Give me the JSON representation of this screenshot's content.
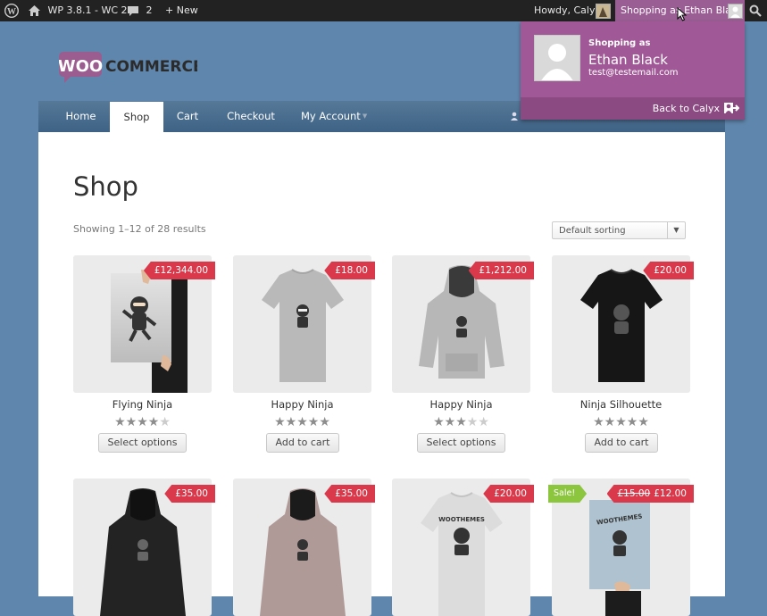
{
  "adminbar": {
    "site": "WP 3.8.1 - WC 2.1",
    "comments": "2",
    "new": "+ New",
    "howdy": "Howdy, Calyx",
    "shopping_as": "Shopping as Ethan Black"
  },
  "dropdown": {
    "label": "Shopping as",
    "name": "Ethan Black",
    "email": "test@testemail.com",
    "back": "Back to Calyx"
  },
  "nav": {
    "items": [
      "Home",
      "Shop",
      "Cart",
      "Checkout",
      "My Account"
    ],
    "active": "Shop"
  },
  "page": {
    "title": "Shop",
    "result_count": "Showing 1–12 of 28 results",
    "sorting": "Default sorting"
  },
  "products": [
    {
      "name": "Flying Ninja",
      "price": "£12,344.00",
      "rating": 4,
      "button": "Select options",
      "image": "poster"
    },
    {
      "name": "Happy Ninja",
      "price": "£18.00",
      "rating": 5,
      "button": "Add to cart",
      "image": "grey-tshirt"
    },
    {
      "name": "Happy Ninja",
      "price": "£1,212.00",
      "rating": 3,
      "button": "Select options",
      "image": "grey-hoodie"
    },
    {
      "name": "Ninja Silhouette",
      "price": "£20.00",
      "rating": 5,
      "button": "Add to cart",
      "image": "black-tshirt"
    },
    {
      "price": "£35.00",
      "image": "black-hoodie"
    },
    {
      "price": "£35.00",
      "image": "mauve-hoodie"
    },
    {
      "price": "£20.00",
      "image": "white-tshirt"
    },
    {
      "price_old": "£15.00",
      "price": "£12.00",
      "sale": "Sale!",
      "image": "poster-blue"
    }
  ],
  "colors": {
    "accent": "#a05896",
    "price_tag": "#d9394a",
    "sale_tag": "#8cc63f",
    "nav": "#4a6e90"
  }
}
